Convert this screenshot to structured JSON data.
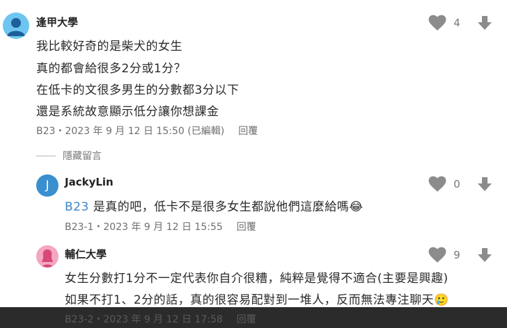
{
  "comments": [
    {
      "author": "逢甲大學",
      "lines": [
        "我比較好奇的是柴犬的女生",
        "真的都會給很多2分或1分？",
        "在低卡的文很多男生的分數都3分以下",
        "還是系統故意顯示低分讓你想課金"
      ],
      "meta": "B23・2023 年 9 月 12 日 15:50 (已編輯)",
      "reply": "回覆",
      "likes": "4"
    }
  ],
  "hide_label": "隱藏留言",
  "replies": [
    {
      "author": "JackyLin",
      "avatar_letter": "J",
      "mention": "B23",
      "text": " 是真的吧，低卡不是很多女生都說他們這麼給嗎😂",
      "meta": "B23-1・2023 年 9 月 12 日 15:55",
      "reply": "回覆",
      "likes": "0"
    },
    {
      "author": "輔仁大學",
      "lines": [
        "女生分數打1分不一定代表你自介很糟，純粹是覺得不適合(主要是興趣)",
        "如果不打1、2分的話，真的很容易配對到一堆人，反而無法專注聊天🥲"
      ],
      "meta": "B23-2・2023 年 9 月 12 日 17:58",
      "reply": "回覆",
      "likes": "9"
    }
  ],
  "colors": {
    "avatar1": "#6ec6f0",
    "avatar2": "#3a8fcf",
    "avatar3": "#f4a7bf",
    "icon": "#8c8c8c"
  }
}
